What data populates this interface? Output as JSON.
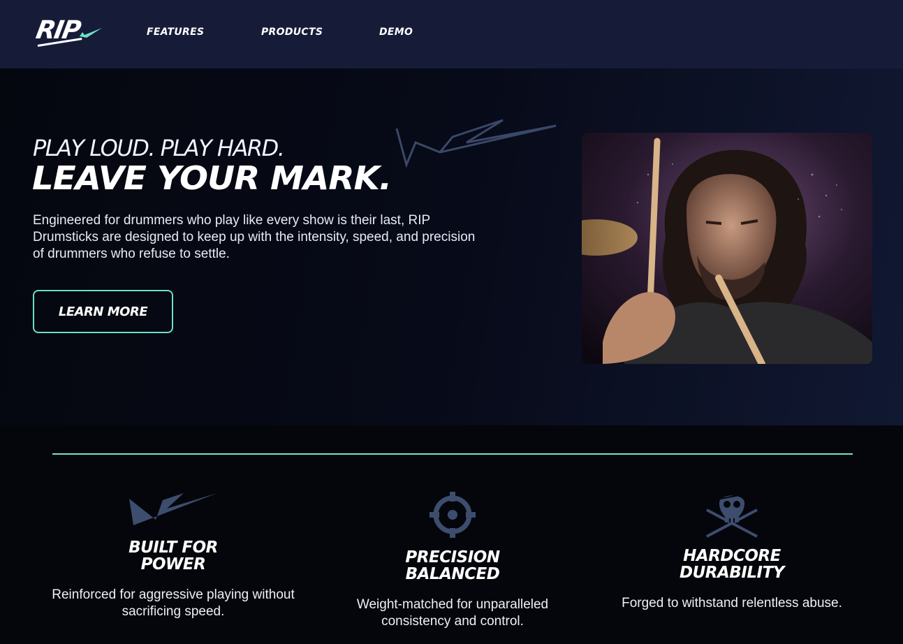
{
  "nav": {
    "logo_text": "RIP",
    "links": [
      {
        "label": "FEATURES"
      },
      {
        "label": "PRODUCTS"
      },
      {
        "label": "DEMO"
      }
    ]
  },
  "hero": {
    "tagline": "PLAY LOUD. PLAY HARD.",
    "headline": "LEAVE YOUR MARK.",
    "description": "Engineered for drummers who play like every show is their last, RIP Drumsticks are designed to keep up with the intensity, speed, and precision of drummers who refuse to settle.",
    "cta_label": "LEARN MORE",
    "photo_alt": "Drummer playing with drumsticks"
  },
  "features": [
    {
      "icon": "paper-plane-icon",
      "title_line1": "BUILT FOR",
      "title_line2": "POWER",
      "description": "Reinforced for aggressive playing without sacrificing speed."
    },
    {
      "icon": "crosshair-icon",
      "title_line1": "PRECISION",
      "title_line2": "BALANCED",
      "description": "Weight-matched for unparalleled consistency and control."
    },
    {
      "icon": "skull-crossbones-icon",
      "title_line1": "HARDCORE",
      "title_line2": "DURABILITY",
      "description": "Forged to withstand relentless abuse."
    }
  ],
  "colors": {
    "nav_bg": "#161c38",
    "accent": "#6de0c6",
    "icon": "#3d4d6e",
    "page_bg": "#05070d"
  }
}
